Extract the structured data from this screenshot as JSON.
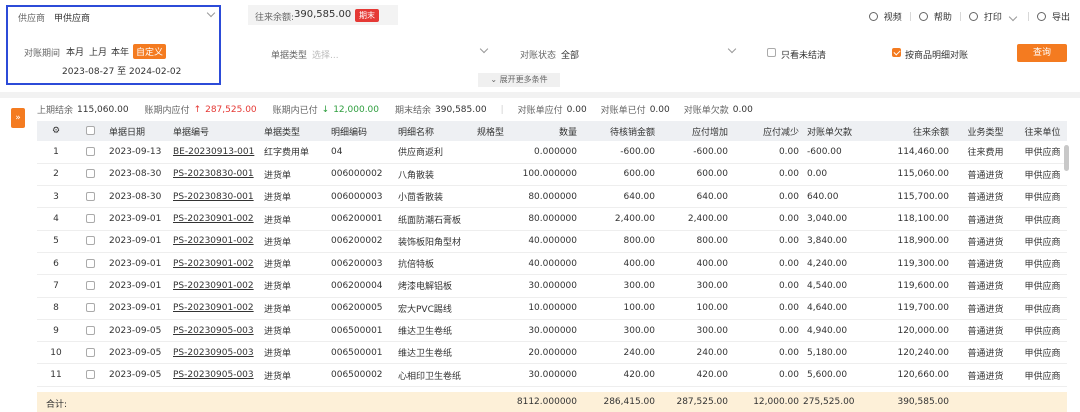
{
  "filters": {
    "supplier_label": "供应商",
    "supplier_value": "甲供应商",
    "balance_label": "往来余额:",
    "balance_value": "390,585.00",
    "balance_tag": "期末",
    "period_label": "对账期间",
    "period_options": [
      "本月",
      "上月",
      "本年",
      "自定义"
    ],
    "date_range": "2023-08-27 至 2024-02-02",
    "doc_type_label": "单据类型",
    "doc_type_placeholder": "选择...",
    "status_label": "对账状态",
    "status_value": "全部",
    "only_unsettled_label": "只看未结清",
    "by_item_label": "按商品明细对账",
    "query_label": "查询",
    "expand_label": "展开更多条件"
  },
  "toolbar": {
    "video_label": "视频",
    "help_label": "帮助",
    "print_label": "打印",
    "export_label": "导出"
  },
  "summary": {
    "opening_label": "上期结余",
    "opening_value": "115,060.00",
    "payable_label": "账期内应付",
    "payable_value": "287,525.00",
    "paid_label": "账期内已付",
    "paid_value": "12,000.00",
    "closing_label": "期末结余",
    "closing_value": "390,585.00",
    "recon_payable_label": "对账单应付",
    "recon_payable_value": "0.00",
    "recon_paid_label": "对账单已付",
    "recon_paid_value": "0.00",
    "recon_owed_label": "对账单欠款",
    "recon_owed_value": "0.00"
  },
  "table": {
    "columns": [
      "单据日期",
      "单据编号",
      "单据类型",
      "明细编码",
      "明细名称",
      "规格型",
      "数量",
      "待核销金额",
      "应付增加",
      "应付减少",
      "对账单欠款",
      "往来余额",
      "业务类型",
      "往来单位"
    ],
    "rows": [
      [
        "1",
        "2023-09-13",
        "BE-20230913-001",
        "红字费用单",
        "04",
        "供应商返利",
        "",
        "0.000000",
        "-600.00",
        "-600.00",
        "0.00",
        "-600.00",
        "114,460.00",
        "往来费用",
        "甲供应商"
      ],
      [
        "2",
        "2023-08-30",
        "PS-20230830-001",
        "进货单",
        "006000002",
        "八角散装",
        "",
        "100.000000",
        "600.00",
        "600.00",
        "0.00",
        "0.00",
        "115,060.00",
        "普通进货",
        "甲供应商"
      ],
      [
        "3",
        "2023-08-30",
        "PS-20230830-001",
        "进货单",
        "006000003",
        "小茴香散装",
        "",
        "80.000000",
        "640.00",
        "640.00",
        "0.00",
        "640.00",
        "115,700.00",
        "普通进货",
        "甲供应商"
      ],
      [
        "4",
        "2023-09-01",
        "PS-20230901-002",
        "进货单",
        "006200001",
        "纸面防潮石膏板",
        "",
        "80.000000",
        "2,400.00",
        "2,400.00",
        "0.00",
        "3,040.00",
        "118,100.00",
        "普通进货",
        "甲供应商"
      ],
      [
        "5",
        "2023-09-01",
        "PS-20230901-002",
        "进货单",
        "006200002",
        "装饰板阳角型材",
        "",
        "40.000000",
        "800.00",
        "800.00",
        "0.00",
        "3,840.00",
        "118,900.00",
        "普通进货",
        "甲供应商"
      ],
      [
        "6",
        "2023-09-01",
        "PS-20230901-002",
        "进货单",
        "006200003",
        "抗倍特板",
        "",
        "40.000000",
        "400.00",
        "400.00",
        "0.00",
        "4,240.00",
        "119,300.00",
        "普通进货",
        "甲供应商"
      ],
      [
        "7",
        "2023-09-01",
        "PS-20230901-002",
        "进货单",
        "006200004",
        "烤漆电解铝板",
        "",
        "30.000000",
        "300.00",
        "300.00",
        "0.00",
        "4,540.00",
        "119,600.00",
        "普通进货",
        "甲供应商"
      ],
      [
        "8",
        "2023-09-01",
        "PS-20230901-002",
        "进货单",
        "006200005",
        "宏大PVC踢线",
        "",
        "10.000000",
        "100.00",
        "100.00",
        "0.00",
        "4,640.00",
        "119,700.00",
        "普通进货",
        "甲供应商"
      ],
      [
        "9",
        "2023-09-05",
        "PS-20230905-003",
        "进货单",
        "006500001",
        "维达卫生卷纸",
        "",
        "30.000000",
        "300.00",
        "300.00",
        "0.00",
        "4,940.00",
        "120,000.00",
        "普通进货",
        "甲供应商"
      ],
      [
        "10",
        "2023-09-05",
        "PS-20230905-003",
        "进货单",
        "006500001",
        "维达卫生卷纸",
        "",
        "20.000000",
        "240.00",
        "240.00",
        "0.00",
        "5,180.00",
        "120,240.00",
        "普通进货",
        "甲供应商"
      ],
      [
        "11",
        "2023-09-05",
        "PS-20230905-003",
        "进货单",
        "006500002",
        "心相印卫生卷纸",
        "",
        "30.000000",
        "420.00",
        "420.00",
        "0.00",
        "5,600.00",
        "120,660.00",
        "普通进货",
        "甲供应商"
      ]
    ],
    "totals_label": "合计:",
    "totals": [
      "8112.000000",
      "286,415.00",
      "287,525.00",
      "12,000.00",
      "275,525.00",
      "390,585.00"
    ]
  }
}
